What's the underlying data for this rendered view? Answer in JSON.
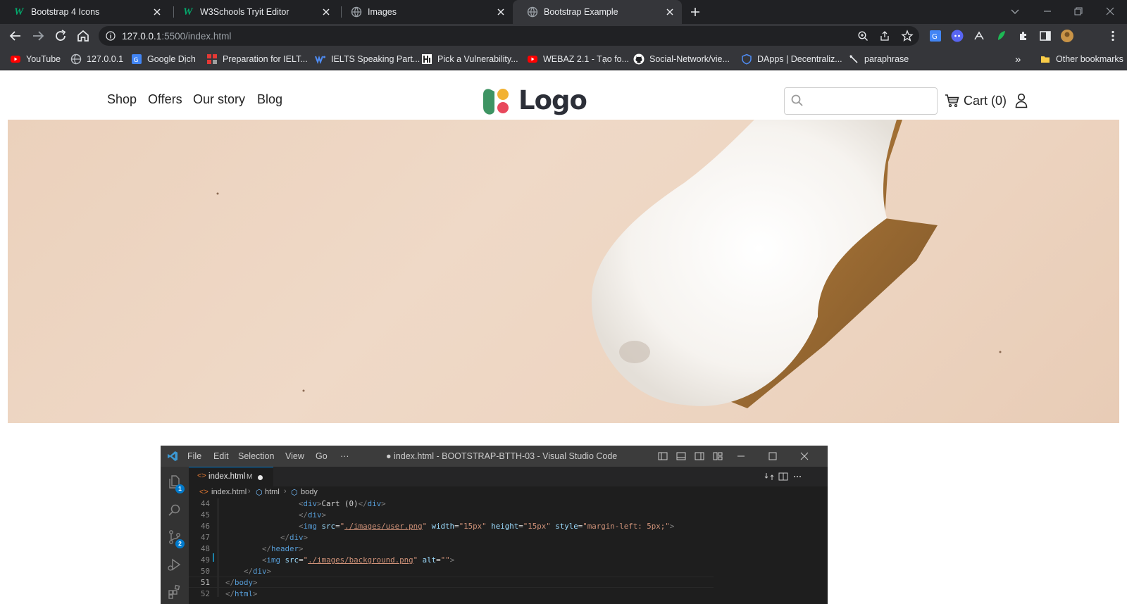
{
  "browser": {
    "tabs": [
      {
        "title": "Bootstrap 4 Icons",
        "favicon": "w3schools-icon"
      },
      {
        "title": "W3Schools Tryit Editor",
        "favicon": "w3schools-icon"
      },
      {
        "title": "Images",
        "favicon": "globe-icon"
      },
      {
        "title": "Bootstrap Example",
        "favicon": "globe-icon",
        "active": true
      }
    ],
    "url_host": "127.0.0.1",
    "url_rest": ":5500/index.html",
    "bookmarks": [
      {
        "label": "YouTube",
        "icon": "youtube-icon"
      },
      {
        "label": "127.0.0.1",
        "icon": "globe-icon"
      },
      {
        "label": "Google Dịch",
        "icon": "translate-icon"
      },
      {
        "label": "Preparation for IELT...",
        "icon": "grid-icon"
      },
      {
        "label": "IELTS Speaking Part...",
        "icon": "ielts-icon"
      },
      {
        "label": "Pick a Vulnerability...",
        "icon": "hack-icon"
      },
      {
        "label": "WEBAZ 2.1 - Tạo fo...",
        "icon": "youtube-icon"
      },
      {
        "label": "Social-Network/vie...",
        "icon": "github-icon"
      },
      {
        "label": "DApps | Decentraliz...",
        "icon": "shield-icon"
      },
      {
        "label": "paraphrase",
        "icon": "quill-icon"
      }
    ],
    "more_label": "»",
    "other_bookmarks": "Other bookmarks"
  },
  "site": {
    "nav": [
      "Shop",
      "Offers",
      "Our story",
      "Blog"
    ],
    "logo_text": "Logo",
    "search_placeholder": "",
    "cart_label": "Cart (0)"
  },
  "vscode": {
    "menu": [
      "File",
      "Edit",
      "Selection",
      "View",
      "Go",
      "···"
    ],
    "window_title": "● index.html - BOOTSTRAP-BTTH-03 - Visual Studio Code",
    "tab_label": "index.html",
    "tab_status": "M",
    "breadcrumb": [
      "index.html",
      "html",
      "body"
    ],
    "explorer_badge": "1",
    "scm_badge": "2",
    "current_line": 51,
    "lines": [
      {
        "n": "44",
        "text": "<div>Cart (0)</div>"
      },
      {
        "n": "45",
        "text": "</div>"
      },
      {
        "n": "46",
        "text": "<img src=\"./images/user.png\" width=\"15px\" height=\"15px\" style=\"margin-left: 5px;\">"
      },
      {
        "n": "47",
        "text": "</div>"
      },
      {
        "n": "48",
        "text": "</header>"
      },
      {
        "n": "49",
        "text": "<img src=\"./images/background.png\" alt=\"\">"
      },
      {
        "n": "50",
        "text": "</div>"
      },
      {
        "n": "51",
        "text": "</body>"
      },
      {
        "n": "52",
        "text": "</html>"
      }
    ]
  },
  "colors": {
    "chrome_dark": "#202124",
    "chrome_toolbar": "#35363a",
    "vscode_blue": "#007acc",
    "hero_bg": "#ecd3bf"
  }
}
